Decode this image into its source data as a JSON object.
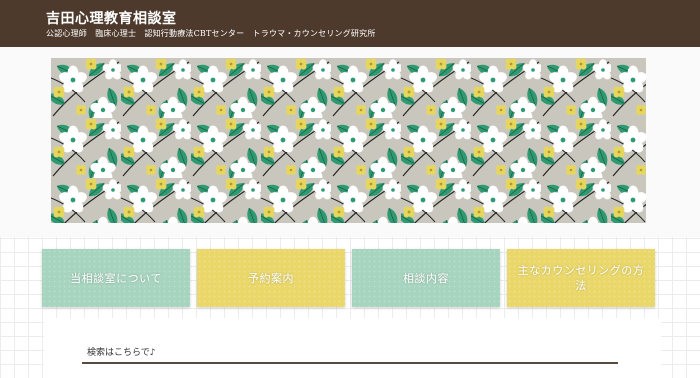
{
  "header": {
    "title": "吉田心理教育相談室",
    "tagline": "公認心理師　臨床心理士　認知行動療法CBTセンター　トラウマ・カウンセリング研究所"
  },
  "banner": {
    "image_icon": "floral-pattern-banner",
    "colors": {
      "background": "#c9c7bd",
      "leaf": "#2e9a72",
      "flower": "#ffffff",
      "yellow_flower": "#e7d65c"
    }
  },
  "nav_tiles": [
    {
      "label": "当相談室について",
      "color": "green"
    },
    {
      "label": "予約案内",
      "color": "yellow"
    },
    {
      "label": "相談内容",
      "color": "green"
    },
    {
      "label": "主なカウンセリングの方法",
      "color": "yellow"
    }
  ],
  "content": {
    "search_heading": "検索はこちらで♪"
  },
  "colors": {
    "header_bg": "#4e3a2c",
    "tile_green": "#a7d4bf",
    "tile_yellow": "#e9d76a"
  }
}
